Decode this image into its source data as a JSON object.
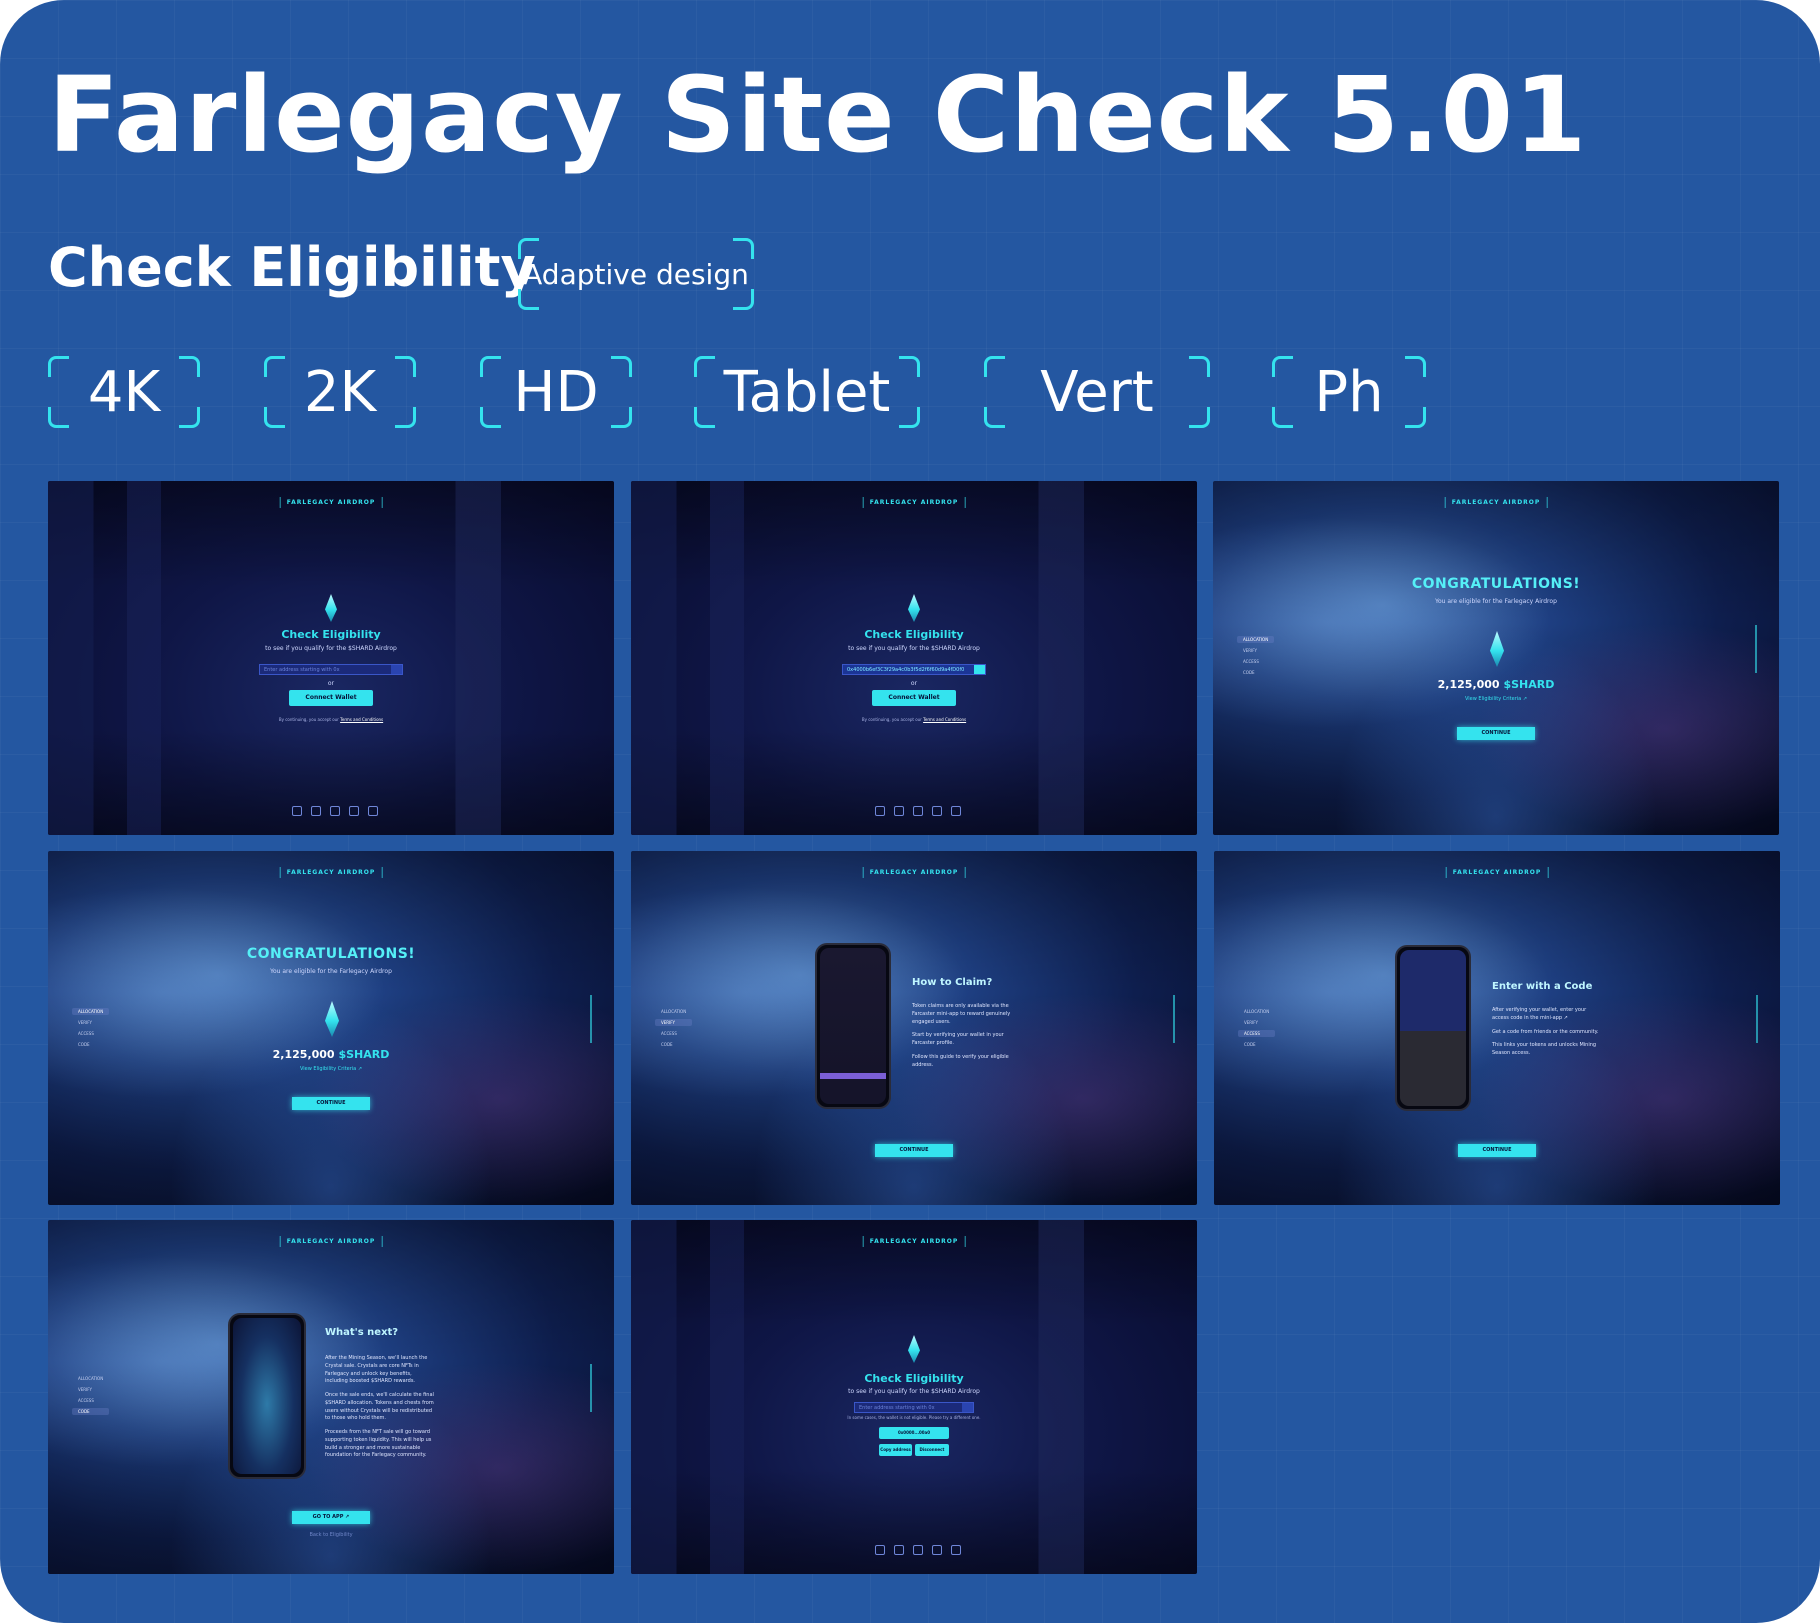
{
  "header": {
    "title": "Farlegacy Site Check 5.01",
    "subtitle": "Check Eligibility",
    "tag": "Adaptive design"
  },
  "breakpoints": [
    {
      "label": "4K"
    },
    {
      "label": "2K"
    },
    {
      "label": "HD"
    },
    {
      "label": "Tablet"
    },
    {
      "label": "Vert"
    },
    {
      "label": "Ph"
    }
  ],
  "common": {
    "logo": "FARLEGACY AIRDROP",
    "check_title": "Check Eligibility",
    "check_sub": "to see if you qualify for the $SHARD Airdrop",
    "input_placeholder": "Enter address starting with 0x",
    "filled_address": "0x4000b6ef3C3f29a4c0b3f5d2f6f60d9a4fD0f0",
    "or": "or",
    "connect_wallet": "Connect Wallet",
    "terms_prefix": "By continuing, you accept our",
    "terms_link": "Terms and Conditions",
    "congrats": "CONGRATULATIONS!",
    "eligible": "You are eligible for the Farlegacy Airdrop",
    "amount": "2,125,000",
    "token": "$SHARD",
    "view_criteria": "View Eligibility Criteria ↗",
    "continue": "CONTINUE",
    "sidebar": [
      "ALLOCATION",
      "VERIFY",
      "ACCESS",
      "CODE"
    ]
  },
  "claim": {
    "title": "How to Claim?",
    "p1": "Token claims are only available via the Farcaster mini-app to reward genuinely engaged users.",
    "p2": "Start by verifying your wallet in your Farcaster profile.",
    "p3": "Follow this guide to verify your eligible address."
  },
  "code": {
    "title": "Enter with a Code",
    "p1": "After verifying your wallet, enter your access code in the mini-app ↗",
    "p2": "Get a code from friends or the community.",
    "p3": "This links your tokens and unlocks Mining Season access."
  },
  "next": {
    "title": "What's next?",
    "p1": "After the Mining Season, we'll launch the Crystal sale. Crystals are core NFTs in Farlegacy and unlock key benefits, including boosted $SHARD rewards.",
    "p2": "Once the sale ends, we'll calculate the final $SHARD allocation. Tokens and chests from users without Crystals will be redistributed to those who hold them.",
    "p3": "Proceeds from the NFT sale will go toward supporting token liquidity. This will help us build a stronger and more sustainable foundation for the Farlegacy community.",
    "go": "GO TO APP ↗",
    "back": "Back to Eligibility"
  },
  "wallet": {
    "hint": "In some cases, the wallet is not eligible. Please try a different one.",
    "addr": "0x0000...00a0",
    "copy": "Copy address",
    "disconnect": "Disconnect"
  }
}
